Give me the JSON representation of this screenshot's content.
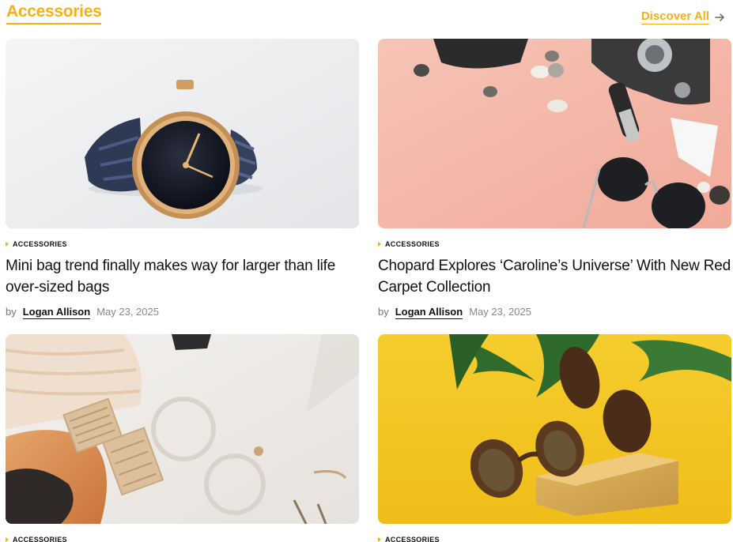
{
  "section": {
    "title": "Accessories",
    "discover_label": "Discover All",
    "accent_color": "#f5b014"
  },
  "cards": [
    {
      "category": "ACCESSORIES",
      "title": "Mini bag trend finally makes way for larger than life over-sized bags",
      "by": "by",
      "author": "Logan Allison",
      "date": "May 23, 2025",
      "image": "wristwatch-photo"
    },
    {
      "category": "ACCESSORIES",
      "title": "Chopard Explores ‘Caroline’s Universe’ With New Red Carpet Collection",
      "by": "by",
      "author": "Logan Allison",
      "date": "May 23, 2025",
      "image": "camera-sunglasses-photo"
    },
    {
      "category": "ACCESSORIES",
      "image": "earrings-photo"
    },
    {
      "category": "ACCESSORIES",
      "image": "tortoise-sunglasses-photo"
    }
  ]
}
